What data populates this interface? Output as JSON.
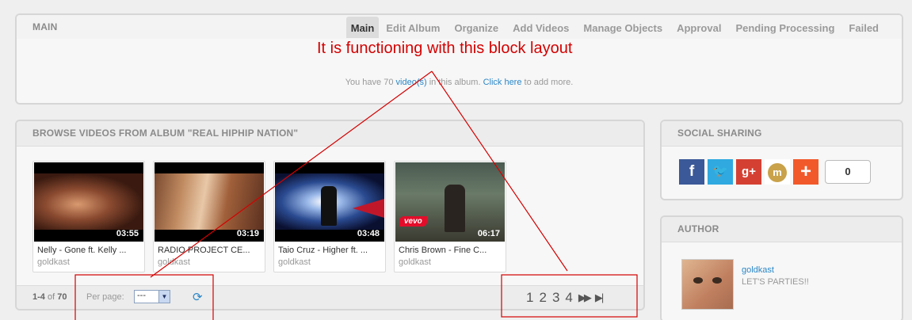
{
  "top": {
    "title": "MAIN",
    "tabs": [
      {
        "label": "Main",
        "active": true
      },
      {
        "label": "Edit Album",
        "active": false
      },
      {
        "label": "Organize",
        "active": false
      },
      {
        "label": "Add Videos",
        "active": false
      },
      {
        "label": "Manage Objects",
        "active": false
      },
      {
        "label": "Approval",
        "active": false
      },
      {
        "label": "Pending Processing",
        "active": false
      },
      {
        "label": "Failed",
        "active": false
      }
    ],
    "info_prefix": "You have 70 ",
    "info_videos_link": "video(s)",
    "info_middle": " in this album. ",
    "info_click_link": "Click here",
    "info_suffix": " to add more."
  },
  "annotation": {
    "text": "It is functioning  with this block layout",
    "color": "#d40000"
  },
  "browse": {
    "title": "BROWSE VIDEOS FROM ALBUM \"REAL HIPHIP NATION\"",
    "videos": [
      {
        "title": "Nelly - Gone ft. Kelly ...",
        "user": "goldkast",
        "duration": "03:55"
      },
      {
        "title": "RADIO PROJECT   CE...",
        "user": "goldkast",
        "duration": "03:19"
      },
      {
        "title": "Taio Cruz - Higher ft. ...",
        "user": "goldkast",
        "duration": "03:48"
      },
      {
        "title": "Chris Brown - Fine C...",
        "user": "goldkast",
        "duration": "06:17",
        "badge": "vevo"
      }
    ],
    "count_range": "1-4",
    "count_of": "of",
    "count_total": "70",
    "per_page_label": "Per page:",
    "per_page_value": "---",
    "refresh_icon": "refresh-icon",
    "pages": [
      "1",
      "2",
      "3",
      "4"
    ],
    "next_icon": "fast-forward-icon",
    "last_icon": "skip-last-icon"
  },
  "social": {
    "title": "SOCIAL SHARING",
    "buttons": [
      {
        "name": "facebook-icon",
        "glyph": "f"
      },
      {
        "name": "twitter-icon",
        "glyph": "t"
      },
      {
        "name": "google-plus-icon",
        "glyph": "g+"
      },
      {
        "name": "mixx-icon",
        "glyph": "m"
      },
      {
        "name": "addthis-icon",
        "glyph": "+"
      }
    ],
    "count": "0"
  },
  "author": {
    "title": "AUTHOR",
    "name": "goldkast",
    "tagline": "LET'S PARTIES!!"
  }
}
